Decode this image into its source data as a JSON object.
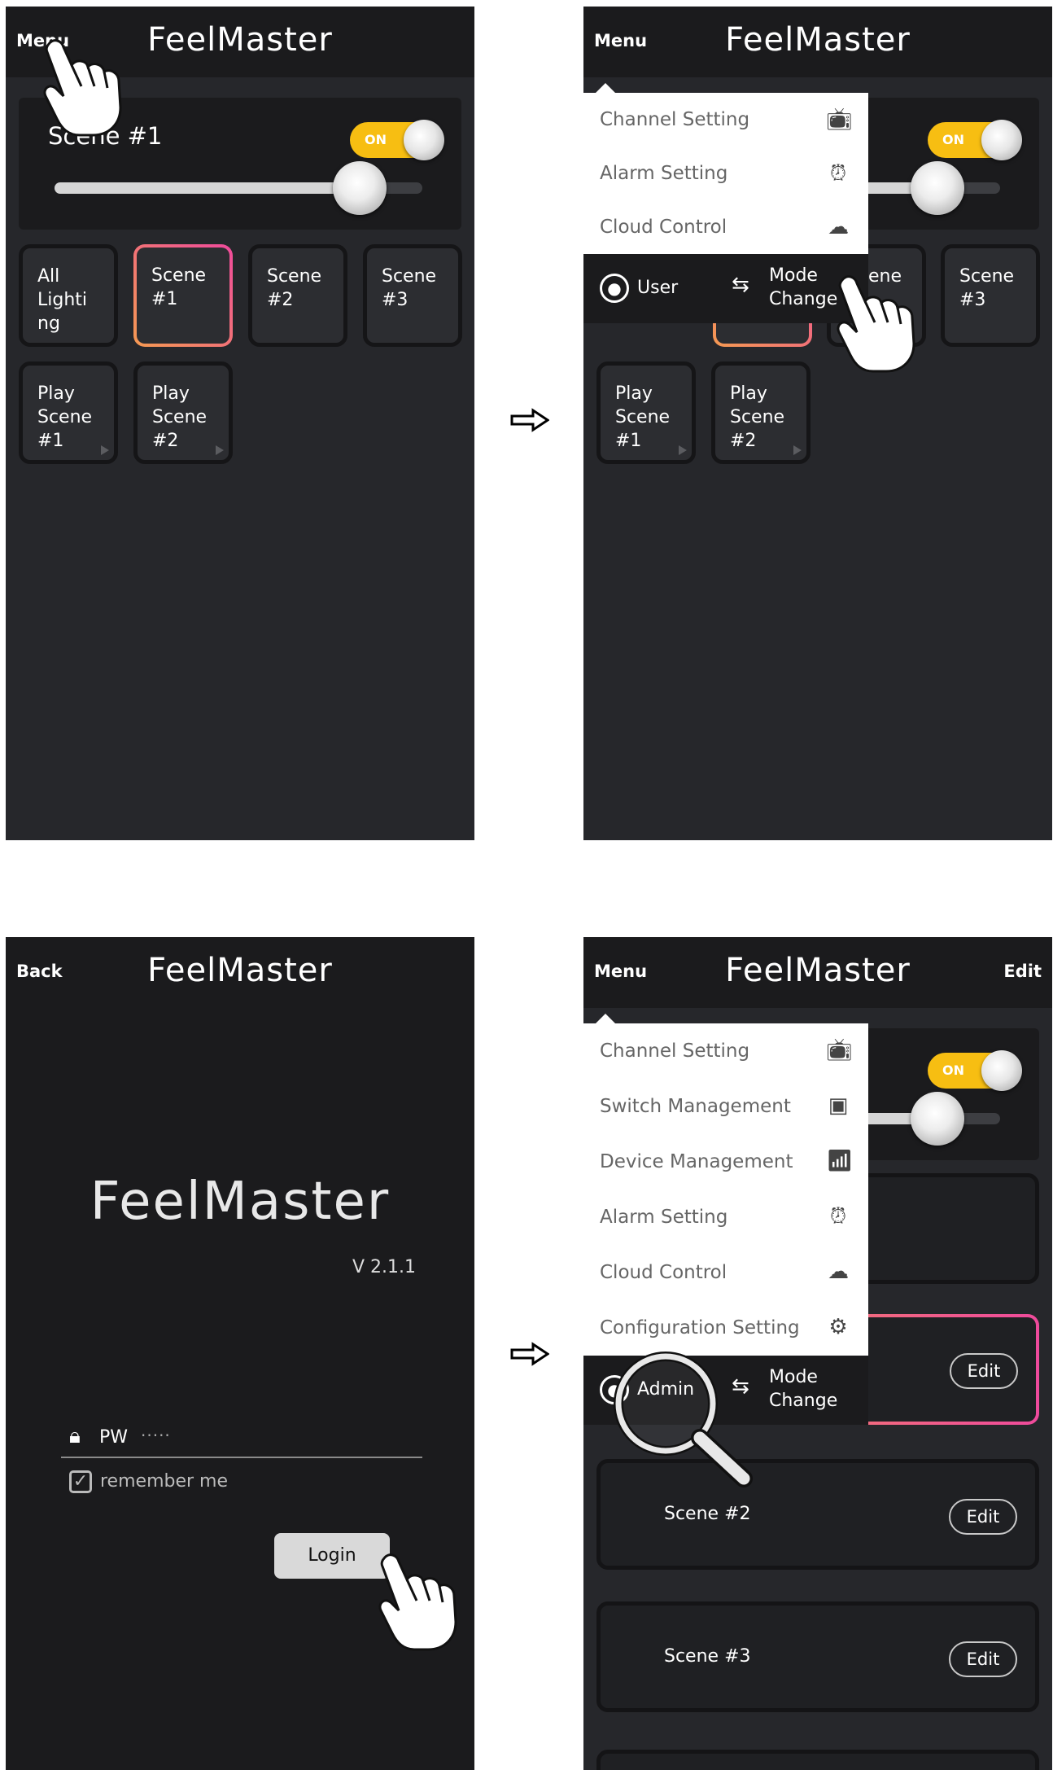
{
  "app": {
    "brand": "FeelMaster"
  },
  "arrows": [
    "right-arrow",
    "right-arrow"
  ],
  "screen1": {
    "menu_label": "Menu",
    "card": {
      "title": "Scene #1",
      "toggle": "ON",
      "brightness": 0.83
    },
    "tiles": [
      {
        "label": "All\nLighti\nng",
        "active": false,
        "play": false
      },
      {
        "label": "Scene\n#1",
        "active": true,
        "play": false
      },
      {
        "label": "Scene\n#2",
        "active": false,
        "play": false
      },
      {
        "label": "Scene\n#3",
        "active": false,
        "play": false
      },
      {
        "label": "Play\nScene\n#1",
        "active": false,
        "play": true
      },
      {
        "label": "Play\nScene\n#2",
        "active": false,
        "play": true
      }
    ]
  },
  "screen2": {
    "menu_label": "Menu",
    "card": {
      "toggle": "ON",
      "brightness": 0.83
    },
    "menu_items": [
      {
        "label": "Channel Setting",
        "icon": "tv-icon"
      },
      {
        "label": "Alarm Setting",
        "icon": "alarm-icon"
      },
      {
        "label": "Cloud Control",
        "icon": "cloud-icon"
      }
    ],
    "menu_user": "User",
    "menu_mode": "Mode\nChange",
    "visible_tiles": [
      {
        "label": "ene"
      },
      {
        "label": "Scene\n#3"
      },
      {
        "label": "Play\nScene\n#1"
      },
      {
        "label": "Play\nScene\n#2"
      }
    ]
  },
  "screen3": {
    "back_label": "Back",
    "logo": "FeelMaster",
    "version": "V 2.1.1",
    "pw_label": "PW",
    "pw_value": "·····",
    "remember_label": "remember me",
    "remember_checked": true,
    "login_button": "Login"
  },
  "screen4": {
    "menu_label": "Menu",
    "edit_label": "Edit",
    "card": {
      "toggle": "ON",
      "brightness": 0.83
    },
    "menu_items": [
      {
        "label": "Channel Setting",
        "icon": "tv-icon"
      },
      {
        "label": "Switch Management",
        "icon": "switch-icon"
      },
      {
        "label": "Device Management",
        "icon": "router-icon"
      },
      {
        "label": "Alarm Setting",
        "icon": "alarm-icon"
      },
      {
        "label": "Cloud Control",
        "icon": "cloud-icon"
      },
      {
        "label": "Configuration Setting",
        "icon": "gear-icon"
      }
    ],
    "menu_user": "Admin",
    "menu_mode": "Mode\nChange",
    "rows": [
      {
        "label": "",
        "edit": "",
        "active": false
      },
      {
        "label": "",
        "edit": "Edit",
        "active": true
      },
      {
        "label": "Scene #2",
        "edit": "Edit",
        "active": false
      },
      {
        "label": "Scene #3",
        "edit": "Edit",
        "active": false
      }
    ]
  }
}
